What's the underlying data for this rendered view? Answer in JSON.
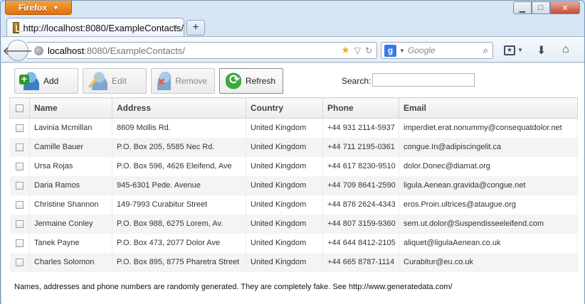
{
  "browser": {
    "app_button": "Firefox",
    "window_controls": {
      "minimize": "▁",
      "maximize": "□",
      "close": "✕"
    },
    "tab": {
      "title": "http://localhost:8080/ExampleContacts/",
      "close": "×"
    },
    "new_tab": "+",
    "url": {
      "host": "localhost",
      "path": ":8080/ExampleContacts/"
    },
    "search_engine_letter": "g",
    "search_placeholder": "Google"
  },
  "toolbar": {
    "add_label": "Add",
    "edit_label": "Edit",
    "remove_label": "Remove",
    "refresh_label": "Refresh",
    "search_label": "Search:",
    "search_value": ""
  },
  "table": {
    "columns": [
      "Name",
      "Address",
      "Country",
      "Phone",
      "Email"
    ],
    "rows": [
      [
        "Lavinia Mcmillan",
        "8609 Mollis Rd.",
        "United Kingdom",
        "+44 931 2114-5937",
        "imperdiet.erat.nonummy@consequatdolor.net"
      ],
      [
        "Camille Bauer",
        "P.O. Box 205, 5585 Nec Rd.",
        "United Kingdom",
        "+44 711 2195-0361",
        "congue.In@adipiscingelit.ca"
      ],
      [
        "Ursa Rojas",
        "P.O. Box 596, 4626 Eleifend, Ave",
        "United Kingdom",
        "+44 617 8230-9510",
        "dolor.Donec@diamat.org"
      ],
      [
        "Daria Ramos",
        "945-6301 Pede. Avenue",
        "United Kingdom",
        "+44 709 8641-2590",
        "ligula.Aenean.gravida@congue.net"
      ],
      [
        "Christine Shannon",
        "149-7993 Curabitur Street",
        "United Kingdom",
        "+44 876 2624-4343",
        "eros.Proin.ultrices@ataugue.org"
      ],
      [
        "Jermaine Conley",
        "P.O. Box 988, 6275 Lorem, Av.",
        "United Kingdom",
        "+44 807 3159-9360",
        "sem.ut.dolor@Suspendisseeleifend.com"
      ],
      [
        "Tanek Payne",
        "P.O. Box 473, 2077 Dolor Ave",
        "United Kingdom",
        "+44 644 8412-2105",
        "aliquet@ligulaAenean.co.uk"
      ],
      [
        "Charles Solomon",
        "P.O. Box 895, 8775 Pharetra Street",
        "United Kingdom",
        "+44 665 8787-1114",
        "Curabitur@eu.co.uk"
      ]
    ]
  },
  "footer_note": "Names, addresses and phone numbers are randomly generated. They are completely fake. See http://www.generatedata.com/"
}
